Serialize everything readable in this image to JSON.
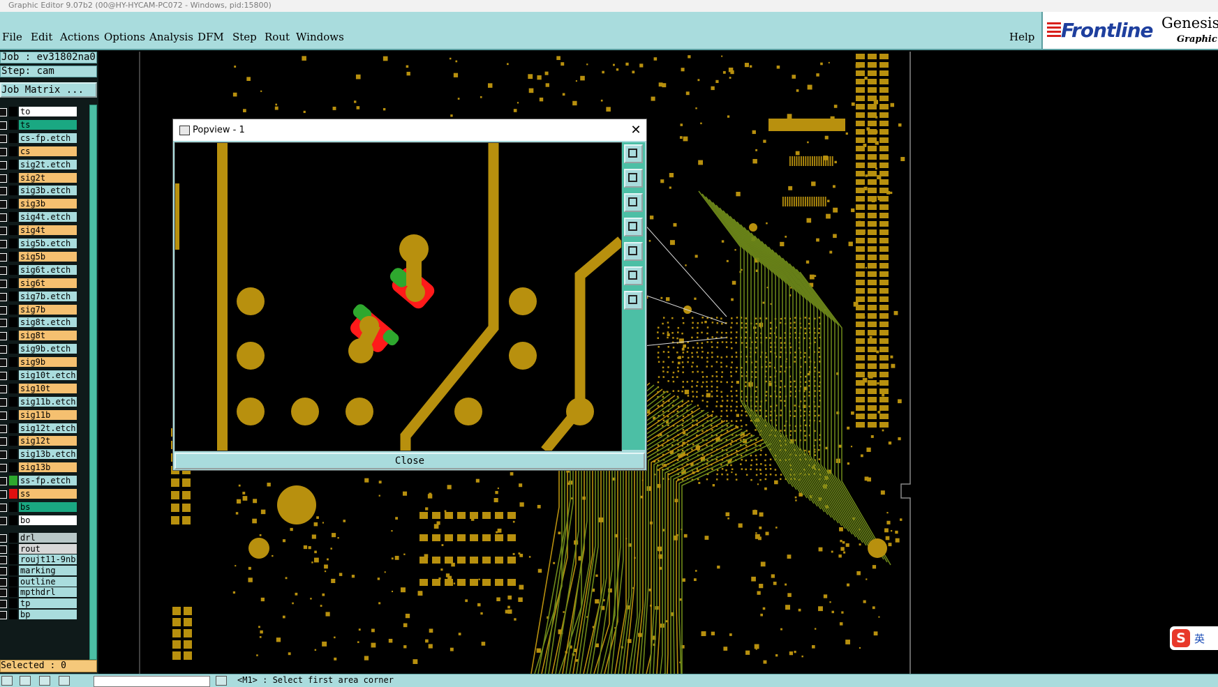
{
  "window": {
    "title": "Graphic Editor 9.07b2 (00@HY-HYCAM-PC072 - Windows, pid:15800)"
  },
  "menu": {
    "file": "File",
    "edit": "Edit",
    "actions": "Actions",
    "options": "Options",
    "analysis": "Analysis",
    "dfm": "DFM",
    "step": "Step",
    "rout": "Rout",
    "windows": "Windows",
    "help": "Help"
  },
  "logo": {
    "brand": "Frontline",
    "product": "Genesis",
    "subtitle": "Graphic E"
  },
  "panel": {
    "job": "Job : ev31802na0",
    "step": "Step: cam",
    "job_matrix": "Job Matrix ...",
    "selected": "Selected : 0"
  },
  "layers": [
    {
      "name": "to",
      "bg": "#ffffff",
      "swatch": "#000000"
    },
    {
      "name": "ts",
      "bg": "#1aa882",
      "swatch": "#000000"
    },
    {
      "name": "cs-fp.etch",
      "bg": "#a9dcdd",
      "swatch": "#000000"
    },
    {
      "name": "cs",
      "bg": "#f5c070",
      "swatch": "#000000"
    },
    {
      "name": "sig2t.etch",
      "bg": "#a9dcdd",
      "swatch": "#000000"
    },
    {
      "name": "sig2t",
      "bg": "#f5c070",
      "swatch": "#000000"
    },
    {
      "name": "sig3b.etch",
      "bg": "#a9dcdd",
      "swatch": "#000000"
    },
    {
      "name": "sig3b",
      "bg": "#f5c070",
      "swatch": "#000000"
    },
    {
      "name": "sig4t.etch",
      "bg": "#a9dcdd",
      "swatch": "#000000"
    },
    {
      "name": "sig4t",
      "bg": "#f5c070",
      "swatch": "#000000"
    },
    {
      "name": "sig5b.etch",
      "bg": "#a9dcdd",
      "swatch": "#000000"
    },
    {
      "name": "sig5b",
      "bg": "#f5c070",
      "swatch": "#000000"
    },
    {
      "name": "sig6t.etch",
      "bg": "#a9dcdd",
      "swatch": "#000000"
    },
    {
      "name": "sig6t",
      "bg": "#f5c070",
      "swatch": "#000000"
    },
    {
      "name": "sig7b.etch",
      "bg": "#a9dcdd",
      "swatch": "#000000"
    },
    {
      "name": "sig7b",
      "bg": "#f5c070",
      "swatch": "#000000"
    },
    {
      "name": "sig8t.etch",
      "bg": "#a9dcdd",
      "swatch": "#000000"
    },
    {
      "name": "sig8t",
      "bg": "#f5c070",
      "swatch": "#000000"
    },
    {
      "name": "sig9b.etch",
      "bg": "#a9dcdd",
      "swatch": "#000000"
    },
    {
      "name": "sig9b",
      "bg": "#f5c070",
      "swatch": "#000000"
    },
    {
      "name": "sig10t.etch",
      "bg": "#a9dcdd",
      "swatch": "#000000"
    },
    {
      "name": "sig10t",
      "bg": "#f5c070",
      "swatch": "#000000"
    },
    {
      "name": "sig11b.etch",
      "bg": "#a9dcdd",
      "swatch": "#000000"
    },
    {
      "name": "sig11b",
      "bg": "#f5c070",
      "swatch": "#000000"
    },
    {
      "name": "sig12t.etch",
      "bg": "#a9dcdd",
      "swatch": "#000000"
    },
    {
      "name": "sig12t",
      "bg": "#f5c070",
      "swatch": "#000000"
    },
    {
      "name": "sig13b.etch",
      "bg": "#a9dcdd",
      "swatch": "#000000"
    },
    {
      "name": "sig13b",
      "bg": "#f5c070",
      "swatch": "#000000"
    },
    {
      "name": "ss-fp.etch",
      "bg": "#a9dcdd",
      "swatch": "#2ea82e"
    },
    {
      "name": "ss",
      "bg": "#f5c070",
      "swatch": "#e01010"
    },
    {
      "name": "bs",
      "bg": "#1aa882",
      "swatch": "#000000"
    },
    {
      "name": "bo",
      "bg": "#ffffff",
      "swatch": "#000000"
    },
    {
      "name": "drl",
      "bg": "#b8c8c8",
      "swatch": "#000000"
    },
    {
      "name": "rout",
      "bg": "#d8d8d8",
      "swatch": "#000000"
    },
    {
      "name": "roujt11-9nb",
      "bg": "#a9dcdd",
      "swatch": "#000000"
    },
    {
      "name": "marking",
      "bg": "#a9dcdd",
      "swatch": "#000000"
    },
    {
      "name": "outline",
      "bg": "#a9dcdd",
      "swatch": "#000000"
    },
    {
      "name": "mpthdrl",
      "bg": "#a9dcdd",
      "swatch": "#000000"
    },
    {
      "name": "tp",
      "bg": "#a9dcdd",
      "swatch": "#000000"
    },
    {
      "name": "bp",
      "bg": "#a9dcdd",
      "swatch": "#000000"
    }
  ],
  "popview": {
    "title": "Popview - 1",
    "close_label": "Close",
    "close_icon": "close-icon"
  },
  "status": {
    "message": "<M1> : Select first area corner"
  },
  "ime": {
    "logo": "S",
    "lang": "英"
  },
  "colors": {
    "panel_bg": "#a9dcdd",
    "copper": "#b8900e",
    "highlight_red": "#ff1a1a",
    "highlight_green": "#2ea82e"
  }
}
